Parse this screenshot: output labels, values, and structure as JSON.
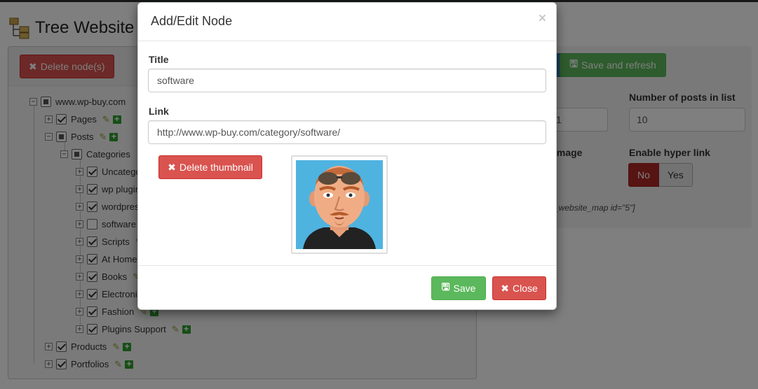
{
  "page": {
    "title": "Tree Website",
    "logo_icon": "tree-folders-icon"
  },
  "left_panel": {
    "delete_button": "Delete node(s)",
    "tree": [
      {
        "label": "www.wp-buy.com",
        "state": "partial",
        "toggle": "−"
      },
      {
        "label": "Pages",
        "state": "checked",
        "toggle": "+"
      },
      {
        "label": "Posts",
        "state": "partial",
        "toggle": "−"
      },
      {
        "label": "Categories",
        "state": "partial",
        "toggle": "−"
      },
      {
        "label": "Uncategorized",
        "state": "checked",
        "toggle": "+"
      },
      {
        "label": "wp plugins",
        "state": "checked",
        "toggle": "+"
      },
      {
        "label": "wordpress",
        "state": "checked",
        "toggle": "+"
      },
      {
        "label": "software",
        "state": "unchecked",
        "toggle": "+"
      },
      {
        "label": "Scripts",
        "state": "checked",
        "toggle": "+"
      },
      {
        "label": "At Home",
        "state": "checked",
        "toggle": "+"
      },
      {
        "label": "Books",
        "state": "checked",
        "toggle": "+"
      },
      {
        "label": "Electronics",
        "state": "checked",
        "toggle": "+"
      },
      {
        "label": "Fashion",
        "state": "checked",
        "toggle": "+"
      },
      {
        "label": "Plugins Support",
        "state": "checked",
        "toggle": "+"
      },
      {
        "label": "Products",
        "state": "checked",
        "toggle": "+"
      },
      {
        "label": "Portfolios",
        "state": "checked",
        "toggle": "+"
      }
    ]
  },
  "right_panel": {
    "save_refresh_button": "Save and refresh",
    "field1_value": "1",
    "posts_label": "Number of posts in list",
    "posts_value": "10",
    "image_label": "image",
    "hyperlink_label": "Enable hyper link",
    "no_label": "No",
    "yes_label": "Yes",
    "shortcode": "_website_map id=\"5\"]"
  },
  "modal": {
    "title": "Add/Edit Node",
    "close_glyph": "×",
    "title_label": "Title",
    "title_value": "software",
    "link_label": "Link",
    "link_value": "http://www.wp-buy.com/category/software/",
    "delete_thumbnail": "Delete thumbnail",
    "save_button": "Save",
    "close_button": "Close"
  },
  "colors": {
    "danger": "#d9534f",
    "success": "#5cb85c",
    "primary": "#337ab7",
    "toggle_no": "#ac2925"
  }
}
